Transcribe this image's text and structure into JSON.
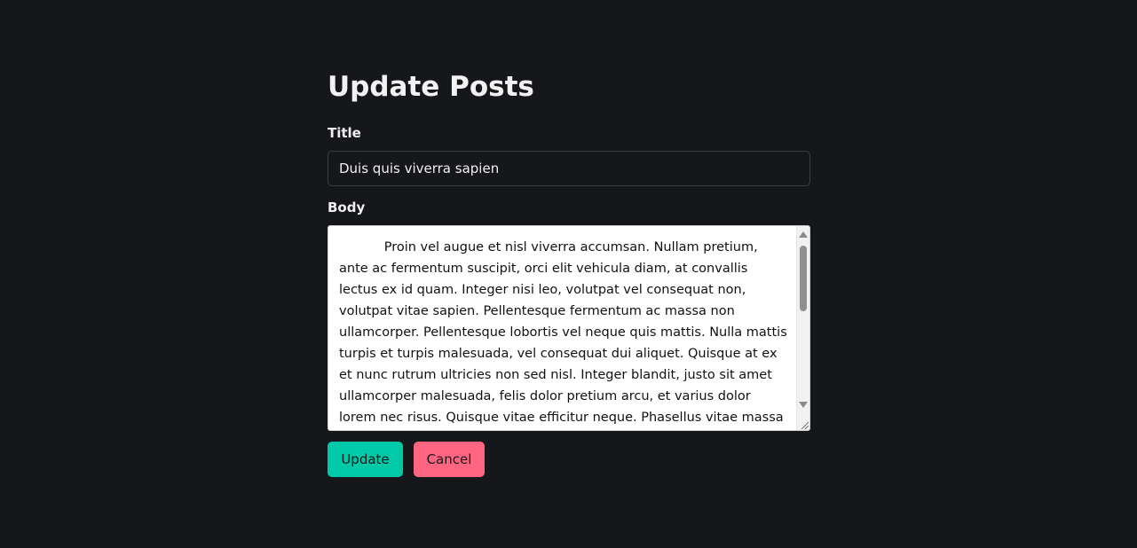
{
  "page": {
    "heading": "Update Posts"
  },
  "form": {
    "title_label": "Title",
    "title_value": "Duis quis viverra sapien",
    "body_label": "Body",
    "body_value": "           Proin vel augue et nisl viverra accumsan. Nullam pretium, ante ac fermentum suscipit, orci elit vehicula diam, at convallis lectus ex id quam. Integer nisi leo, volutpat vel consequat non, volutpat vitae sapien. Pellentesque fermentum ac massa non ullamcorper. Pellentesque lobortis vel neque quis mattis. Nulla mattis turpis et turpis malesuada, vel consequat dui aliquet. Quisque at ex et nunc rutrum ultricies non sed nisl. Integer blandit, justo sit amet ullamcorper malesuada, felis dolor pretium arcu, et varius dolor lorem nec risus. Quisque vitae efficitur neque. Phasellus vitae massa posuere, tempus"
  },
  "actions": {
    "update_label": "Update",
    "cancel_label": "Cancel"
  },
  "colors": {
    "background": "#16171b",
    "update_button": "#00c9a7",
    "cancel_button": "#ff6480"
  },
  "icons": {
    "scroll_up": "scroll-up-arrow-icon",
    "scroll_down": "scroll-down-arrow-icon",
    "resize": "resize-grip-icon"
  }
}
